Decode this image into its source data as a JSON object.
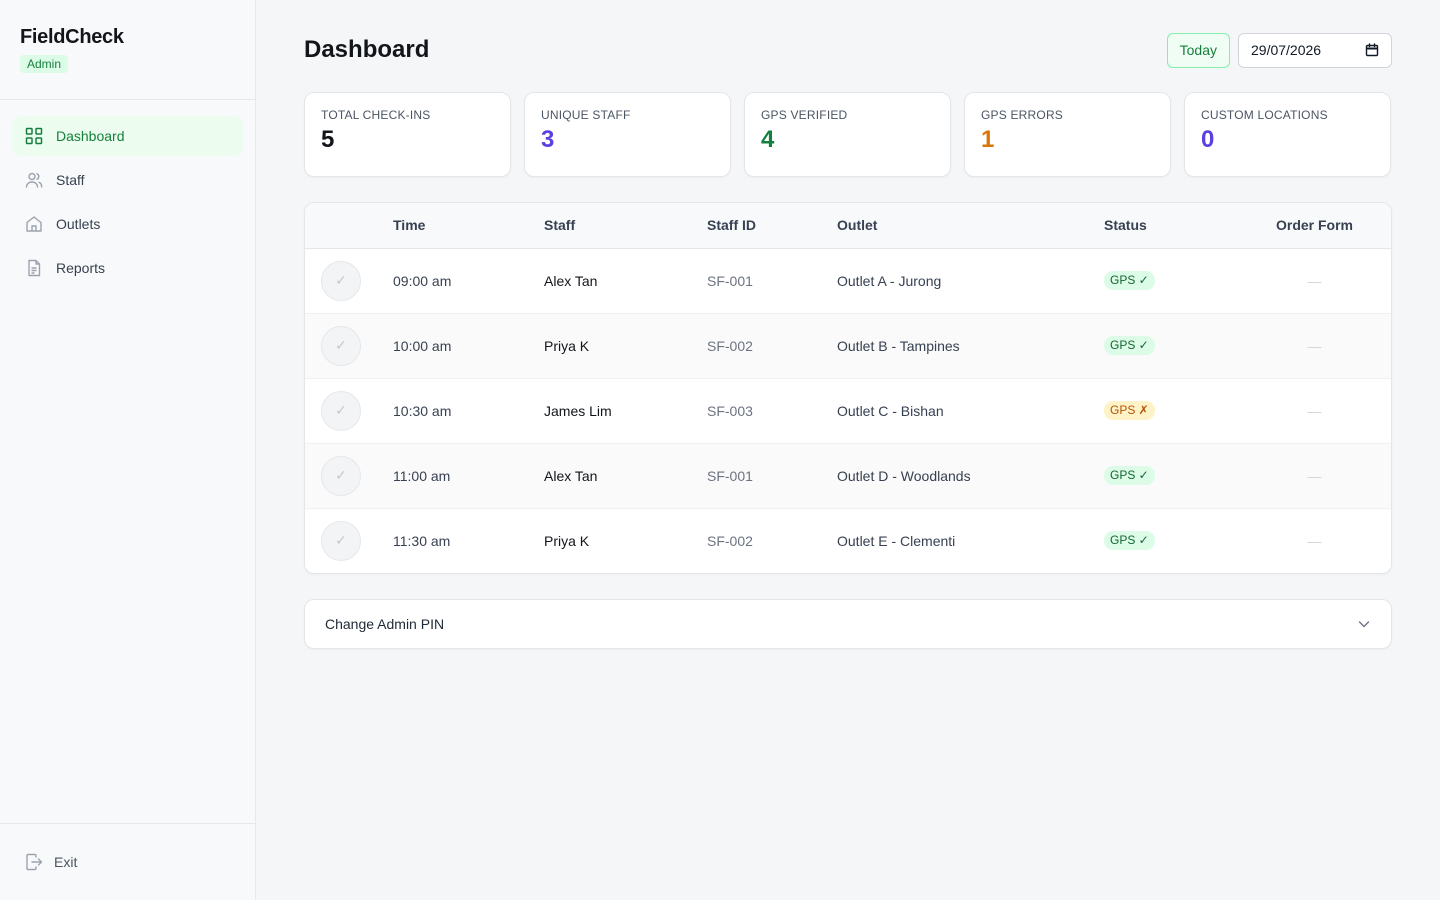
{
  "brand": {
    "name": "FieldCheck",
    "role": "Admin"
  },
  "nav": [
    {
      "label": "Dashboard",
      "icon": "grid-icon",
      "active": true
    },
    {
      "label": "Staff",
      "icon": "users-icon"
    },
    {
      "label": "Outlets",
      "icon": "home-icon"
    },
    {
      "label": "Reports",
      "icon": "document-icon"
    }
  ],
  "footer": {
    "exit_label": "Exit"
  },
  "header": {
    "title": "Dashboard",
    "today_label": "Today",
    "date_value": "29/07/2026"
  },
  "stats": [
    {
      "label": "TOTAL CHECK-INS",
      "value": "5",
      "color": "#12151a"
    },
    {
      "label": "UNIQUE STAFF",
      "value": "3",
      "color": "#5b3fe0"
    },
    {
      "label": "GPS VERIFIED",
      "value": "4",
      "color": "#15803d"
    },
    {
      "label": "GPS ERRORS",
      "value": "1",
      "color": "#d97706"
    },
    {
      "label": "CUSTOM LOCATIONS",
      "value": "0",
      "color": "#5b3fe0"
    }
  ],
  "table": {
    "headers": {
      "time": "Time",
      "staff": "Staff",
      "staff_id": "Staff ID",
      "outlet": "Outlet",
      "status": "Status",
      "order_form": "Order Form"
    },
    "rows": [
      {
        "check": "✓",
        "time": "09:00 am",
        "staff": "Alex Tan",
        "staff_id": "SF-001",
        "outlet": "Outlet A - Jurong",
        "status": "GPS ✓",
        "ok": true,
        "order_form": "—"
      },
      {
        "check": "✓",
        "time": "10:00 am",
        "staff": "Priya K",
        "staff_id": "SF-002",
        "outlet": "Outlet B - Tampines",
        "status": "GPS ✓",
        "ok": true,
        "order_form": "—"
      },
      {
        "check": "✓",
        "time": "10:30 am",
        "staff": "James Lim",
        "staff_id": "SF-003",
        "outlet": "Outlet C - Bishan",
        "status": "GPS ✗",
        "ok": false,
        "order_form": "—"
      },
      {
        "check": "✓",
        "time": "11:00 am",
        "staff": "Alex Tan",
        "staff_id": "SF-001",
        "outlet": "Outlet D - Woodlands",
        "status": "GPS ✓",
        "ok": true,
        "order_form": "—"
      },
      {
        "check": "✓",
        "time": "11:30 am",
        "staff": "Priya K",
        "staff_id": "SF-002",
        "outlet": "Outlet E - Clementi",
        "status": "GPS ✓",
        "ok": true,
        "order_form": "—"
      }
    ]
  },
  "pin": {
    "title": "Change Admin PIN"
  }
}
